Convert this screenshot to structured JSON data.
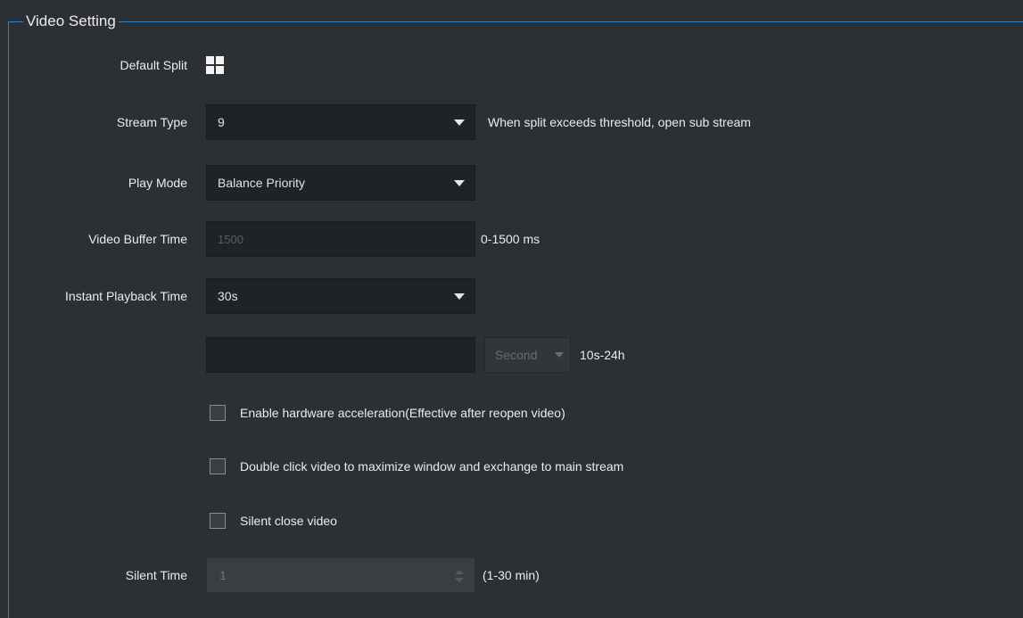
{
  "group": {
    "title": "Video Setting"
  },
  "default_split": {
    "label": "Default Split",
    "icon": "grid-2x2-icon"
  },
  "stream_type": {
    "label": "Stream Type",
    "value": "9",
    "hint": "When split exceeds threshold, open sub stream"
  },
  "play_mode": {
    "label": "Play Mode",
    "value": "Balance Priority"
  },
  "video_buffer_time": {
    "label": "Video Buffer Time",
    "placeholder": "1500",
    "hint": "0-1500 ms"
  },
  "instant_playback_time": {
    "label": "Instant Playback Time",
    "value": "30s"
  },
  "custom_playback": {
    "value": "",
    "unit": "Second",
    "hint": "10s-24h"
  },
  "checkboxes": [
    {
      "label": "Enable hardware acceleration(Effective after reopen video)",
      "checked": false
    },
    {
      "label": "Double click video to maximize window and exchange to main stream",
      "checked": false
    },
    {
      "label": "Silent close video",
      "checked": false
    }
  ],
  "silent_time": {
    "label": "Silent Time",
    "value": "1",
    "hint": "(1-30 min)"
  },
  "colors": {
    "background": "#2c2f34",
    "accent_border": "#2a86c8",
    "input_bg": "#1f2226"
  }
}
